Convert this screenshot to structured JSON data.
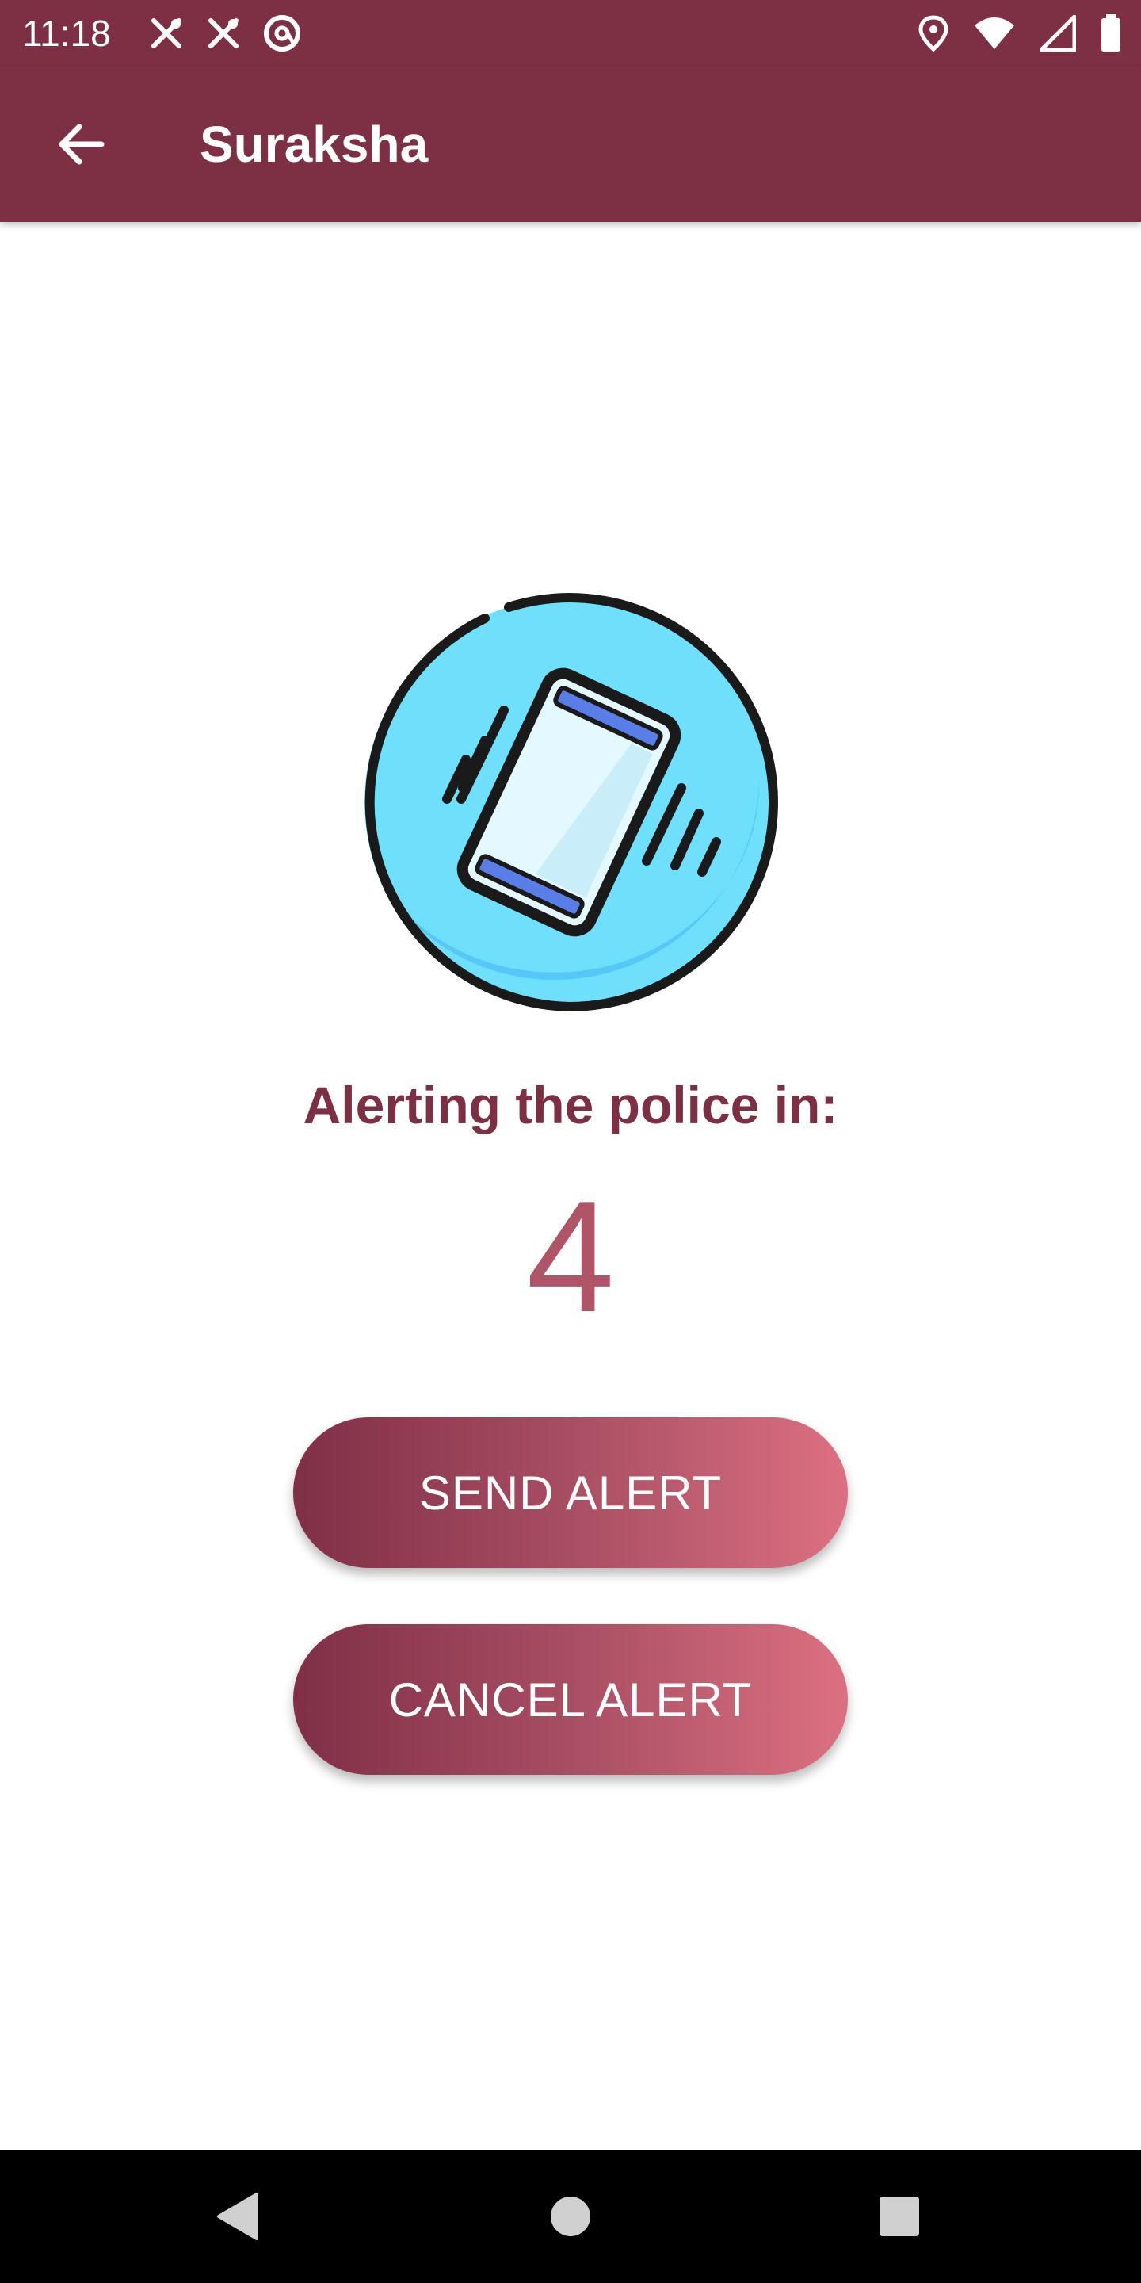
{
  "status_bar": {
    "time": "11:18",
    "left_icons": [
      "fork-knife-icon",
      "fork-knife-icon",
      "at-sign-icon"
    ],
    "right_icons": [
      "location-pin-icon",
      "wifi-icon",
      "signal-icon",
      "battery-icon"
    ]
  },
  "app_bar": {
    "title": "Suraksha",
    "back_icon": "arrow-left-icon"
  },
  "main": {
    "illustration_icon": "vibrating-phone-icon",
    "heading": "Alerting the police in:",
    "countdown": "4",
    "send_label": "SEND ALERT",
    "cancel_label": "CANCEL ALERT"
  },
  "nav_bar": {
    "back_icon": "triangle-back-icon",
    "home_icon": "circle-home-icon",
    "recents_icon": "square-recents-icon"
  },
  "colors": {
    "primary": "#7d2f44",
    "countdown": "#b05468",
    "button_gradient_start": "#7f2f46",
    "button_gradient_end": "#dc7082",
    "illustration_circle": "#6fe0fb"
  }
}
